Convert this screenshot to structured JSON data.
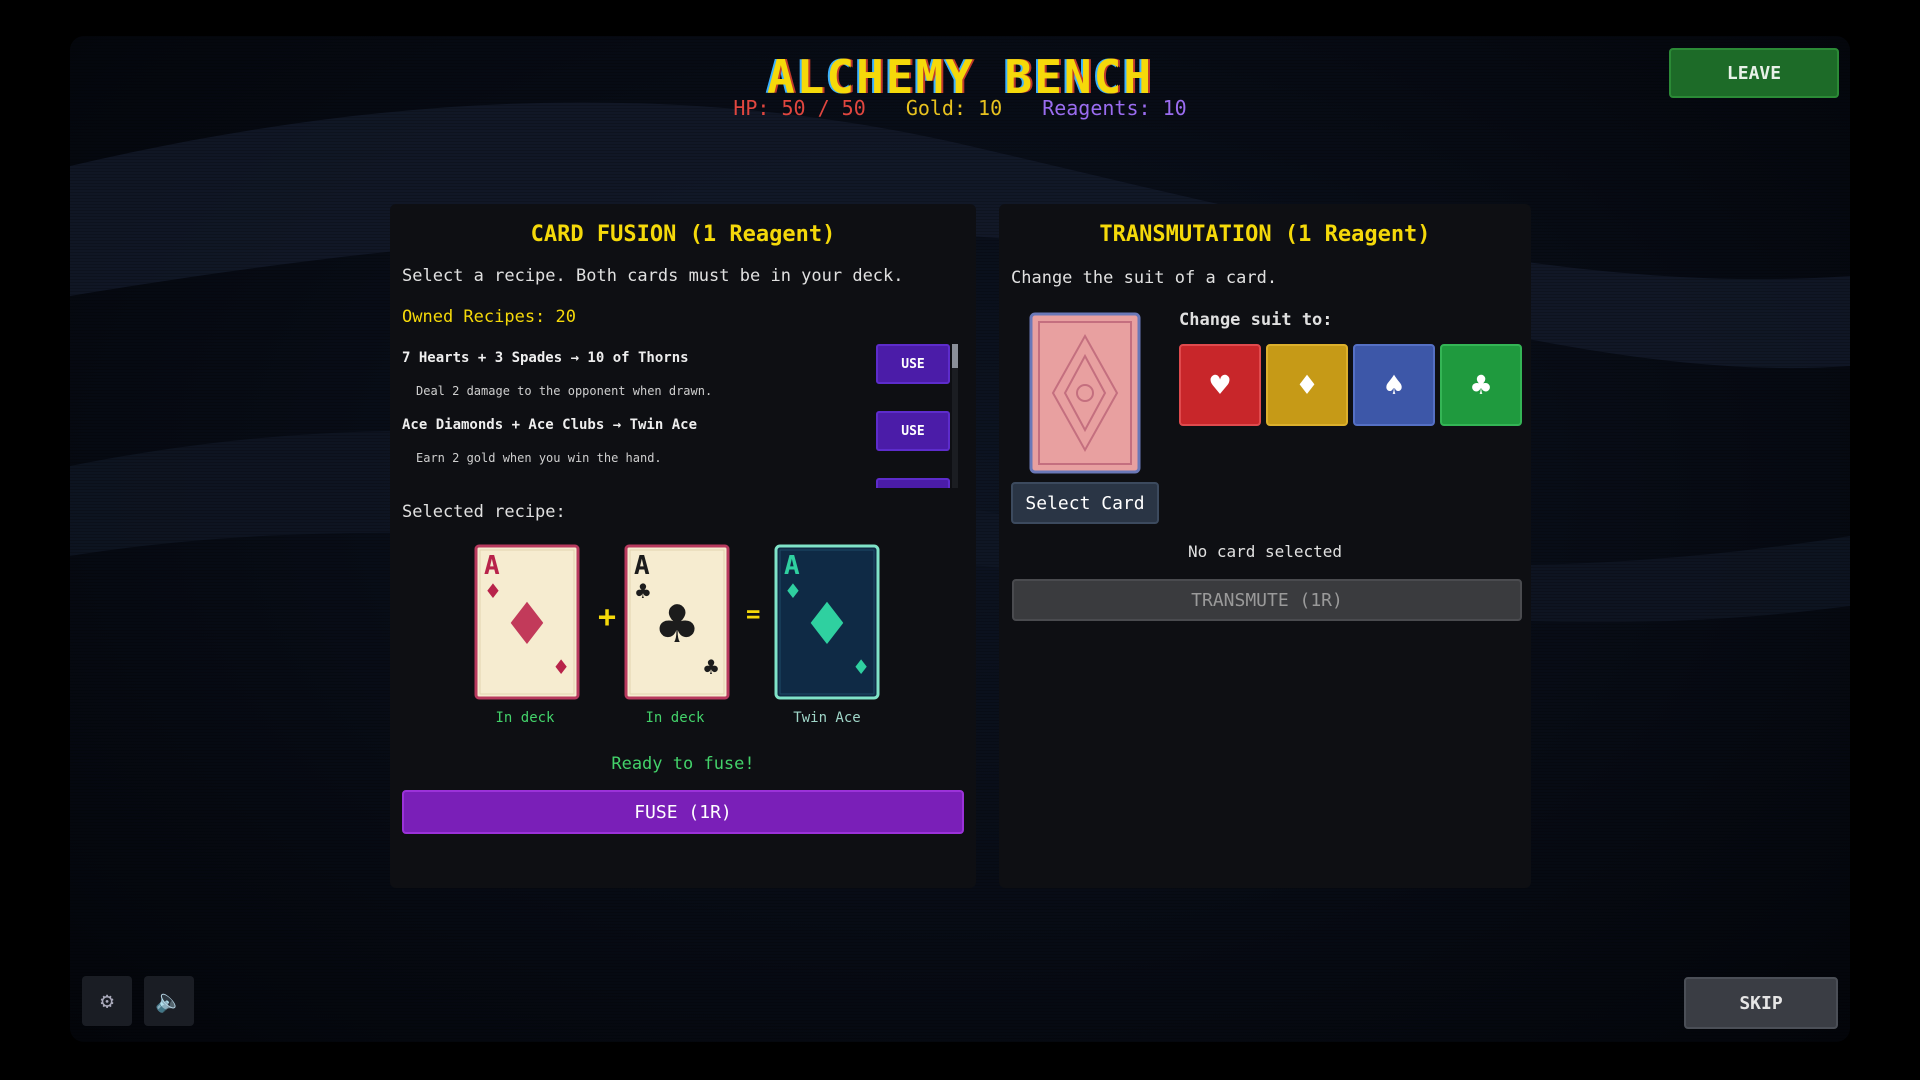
{
  "header": {
    "title": "ALCHEMY BENCH",
    "hp": "HP: 50 / 50",
    "gold": "Gold: 10",
    "reagents": "Reagents: 10",
    "leave_label": "LEAVE"
  },
  "fusion": {
    "title": "CARD FUSION  (1 Reagent)",
    "instructions": "Select a recipe. Both cards must be in your deck.",
    "owned": "Owned Recipes: 20",
    "recipes": [
      {
        "formula": "7 Hearts + 3 Spades → 10 of Thorns",
        "desc": "Deal 2 damage to the opponent when drawn.",
        "use_label": "USE"
      },
      {
        "formula": "Ace Diamonds + Ace Clubs → Twin Ace",
        "desc": "Earn 2 gold when you win the hand.",
        "use_label": "USE"
      }
    ],
    "selected_label": "Selected recipe:",
    "cards": [
      {
        "rank": "A",
        "suit": "♦",
        "label": "In deck"
      },
      {
        "rank": "A",
        "suit": "♣",
        "label": "In deck"
      },
      {
        "rank": "A",
        "suit": "♦",
        "label": "Twin Ace"
      }
    ],
    "plus": "+",
    "equals": "=",
    "status": "Ready to fuse!",
    "fuse_label": "FUSE  (1R)"
  },
  "transmutation": {
    "title": "TRANSMUTATION  (1 Reagent)",
    "instructions": "Change the suit of a card.",
    "change_label": "Change suit to:",
    "select_label": "Select Card",
    "status": "No card selected",
    "transmute_label": "TRANSMUTE  (1R)",
    "suits": [
      {
        "name": "hearts",
        "glyph": "♥",
        "color": "#c8262a"
      },
      {
        "name": "diamonds",
        "glyph": "♦",
        "color": "#c69a17"
      },
      {
        "name": "spades",
        "glyph": "♠",
        "color": "#3d57a8"
      },
      {
        "name": "clubs",
        "glyph": "♣",
        "color": "#1f9a3e"
      }
    ]
  },
  "footer": {
    "settings_icon": "gear-icon",
    "sound_icon": "speaker-icon",
    "skip_label": "SKIP"
  }
}
